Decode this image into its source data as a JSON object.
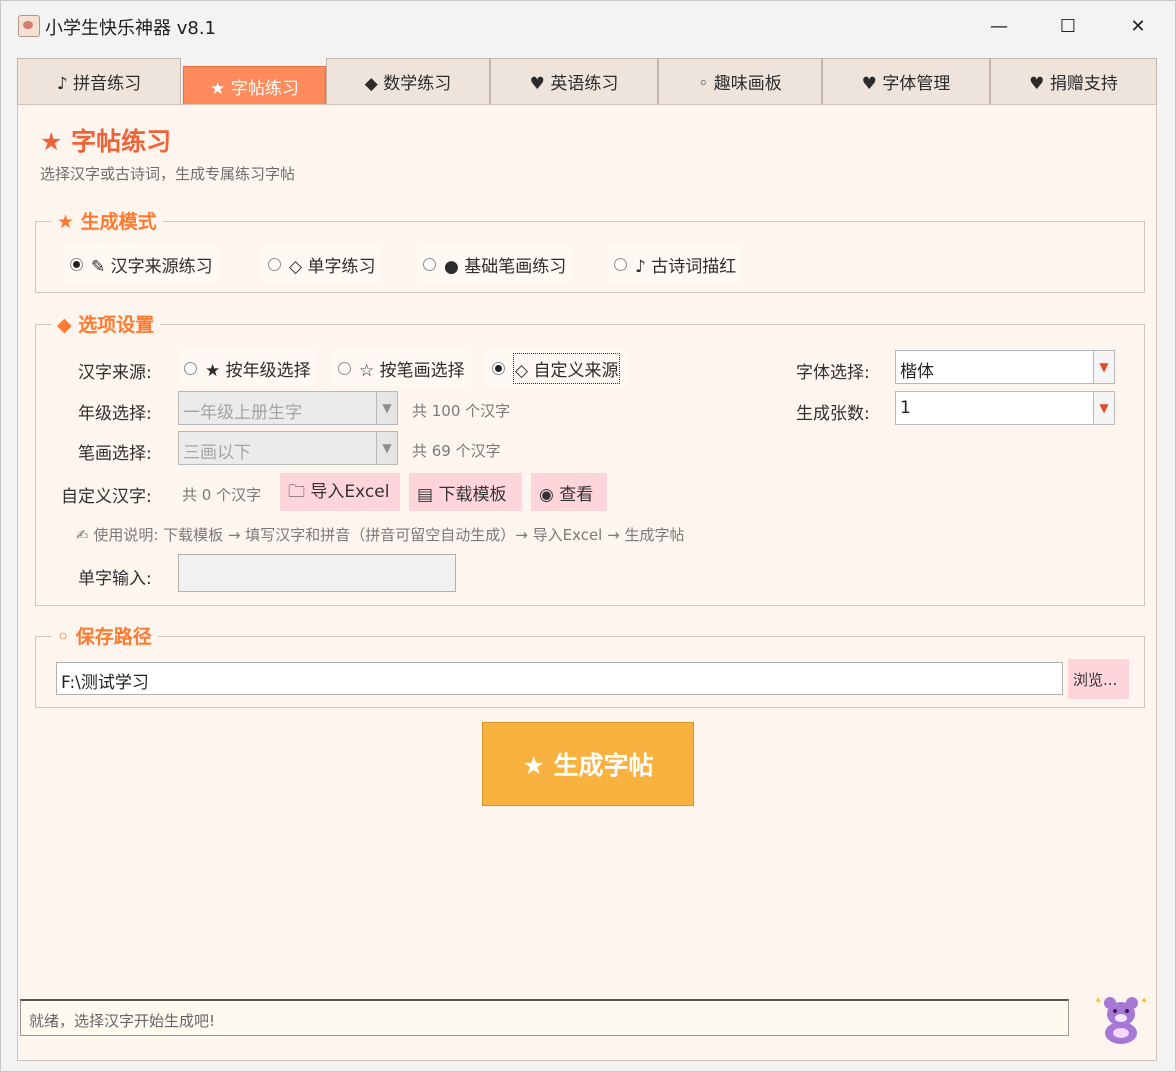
{
  "window": {
    "title": "小学生快乐神器 v8.1",
    "controls": {
      "minimize": "—",
      "maximize": "☐",
      "close": "✕"
    }
  },
  "tabs": [
    {
      "label": "♪ 拼音练习"
    },
    {
      "label": "★ 字帖练习",
      "active": true
    },
    {
      "label": "◆ 数学练习"
    },
    {
      "label": "♥ 英语练习"
    },
    {
      "label": "◦ 趣味画板"
    },
    {
      "label": "♥ 字体管理"
    },
    {
      "label": "♥ 捐赠支持"
    }
  ],
  "page": {
    "title": "★ 字帖练习",
    "subtitle": "选择汉字或古诗词，生成专属练习字帖"
  },
  "mode_group": {
    "legend": "★ 生成模式",
    "options": [
      {
        "label": "✎ 汉字来源练习",
        "selected": true
      },
      {
        "label": "◇ 单字练习",
        "selected": false
      },
      {
        "label": "● 基础笔画练习",
        "selected": false
      },
      {
        "label": "♪ 古诗词描红",
        "selected": false
      }
    ]
  },
  "options_group": {
    "legend": "◆ 选项设置",
    "source_label": "汉字来源:",
    "source_options": [
      {
        "label": "★ 按年级选择",
        "selected": false
      },
      {
        "label": "☆ 按笔画选择",
        "selected": false
      },
      {
        "label": "◇ 自定义来源",
        "selected": true
      }
    ],
    "grade_label": "年级选择:",
    "grade_value": "一年级上册生字",
    "grade_count": "共 100 个汉字",
    "stroke_label": "笔画选择:",
    "stroke_value": "三画以下",
    "stroke_count": "共 69 个汉字",
    "custom_label": "自定义汉字:",
    "custom_count": "共 0 个汉字",
    "import_button": "🗀 导入Excel",
    "download_button": "▤ 下载模板",
    "view_button": "◉ 查看",
    "instructions": "✍ 使用说明: 下载模板 → 填写汉字和拼音（拼音可留空自动生成）→ 导入Excel → 生成字帖",
    "single_label": "单字输入:",
    "single_value": "",
    "font_label": "字体选择:",
    "font_value": "楷体",
    "count_label": "生成张数:",
    "count_value": "1"
  },
  "save_group": {
    "legend": "◦ 保存路径",
    "path": "F:\\测试学习",
    "browse_button": "浏览..."
  },
  "generate_button": "★ 生成字帖",
  "status": "就绪，选择汉字开始生成吧!",
  "colors": {
    "accent": "#ff8a5c",
    "legend": "#ff7a2f",
    "panel_bg": "#fff5ef",
    "pink_button": "#ffd5dc",
    "generate": "#f9b240"
  }
}
